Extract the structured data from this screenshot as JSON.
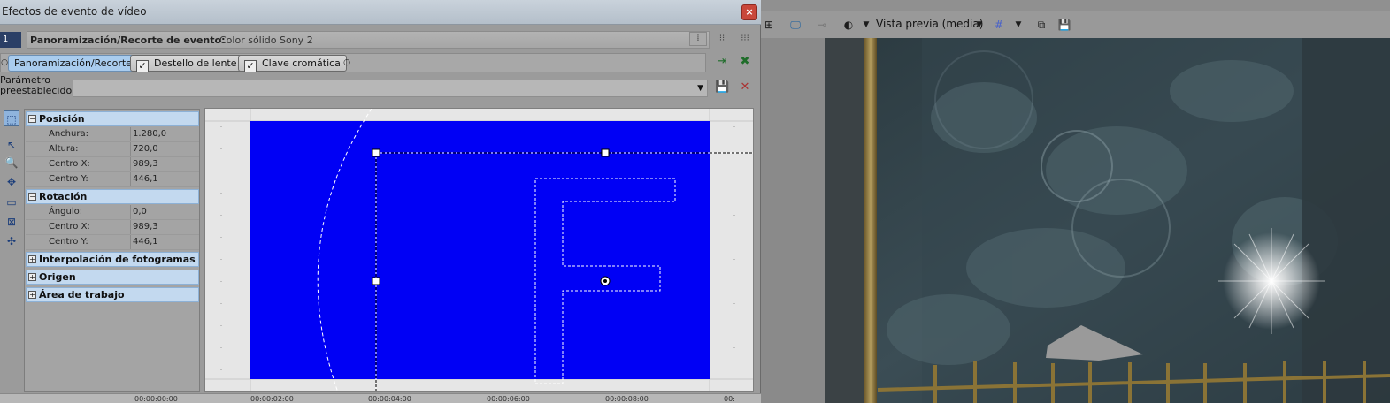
{
  "window": {
    "title": "Efectos de evento de vídeo",
    "close_glyph": "×"
  },
  "event": {
    "track_chip": "1",
    "label": "Panoramización/Recorte de evento:",
    "value": "Color sólido Sony 2"
  },
  "chain": {
    "plugins": [
      {
        "label": "Panoramización/Recorte"
      },
      {
        "label": "Destello de lente"
      },
      {
        "label": "Clave cromática"
      }
    ]
  },
  "preset": {
    "label_line1": "Parámetro",
    "label_line2": "preestablecido:",
    "value": ""
  },
  "sections": {
    "position": {
      "title": "Posición"
    },
    "rotation": {
      "title": "Rotación"
    },
    "interp": {
      "title": "Interpolación de fotogramas c..."
    },
    "origin": {
      "title": "Origen"
    },
    "workarea": {
      "title": "Área de trabajo"
    }
  },
  "position_props": [
    {
      "name": "Anchura:",
      "value": "1.280,0"
    },
    {
      "name": "Altura:",
      "value": "720,0"
    },
    {
      "name": "Centro X:",
      "value": "989,3"
    },
    {
      "name": "Centro Y:",
      "value": "446,1"
    }
  ],
  "rotation_props": [
    {
      "name": "Ángulo:",
      "value": "0,0"
    },
    {
      "name": "Centro X:",
      "value": "989,3"
    },
    {
      "name": "Centro Y:",
      "value": "446,1"
    }
  ],
  "timeline": {
    "marks": [
      "00:00:00:00",
      "00:00:02:00",
      "00:00:04:00",
      "00:00:06:00",
      "00:00:08:00",
      "00:"
    ]
  },
  "preview_toolbar": {
    "mode_label": "Vista previa (media)"
  },
  "colors": {
    "frame_blue": "#0000f5",
    "plugin_active": "#a9ccee",
    "section_bg": "#c3d9ef"
  }
}
